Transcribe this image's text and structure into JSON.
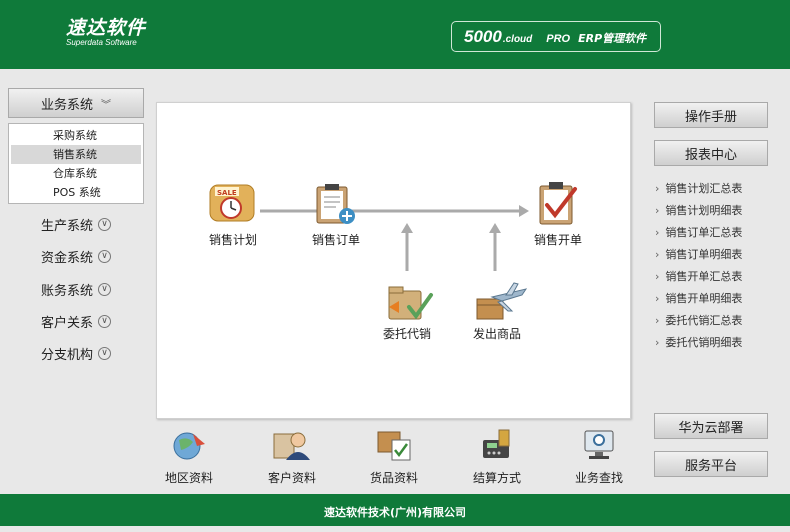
{
  "header": {
    "logo_cn": "速达软件",
    "logo_en": "Superdata Software",
    "brand_num": "5000",
    "brand_cloud": ".cloud",
    "brand_pro": "PRO",
    "brand_erp": "ERP管理软件"
  },
  "sidebar": {
    "active_menu": "业务系统",
    "submenu": [
      "采购系统",
      "销售系统",
      "仓库系统",
      "POS 系统"
    ],
    "selected_submenu": "销售系统",
    "menus": [
      "生产系统",
      "资金系统",
      "账务系统",
      "客户关系",
      "分支机构"
    ]
  },
  "flow": {
    "sales_plan": "销售计划",
    "sales_order": "销售订单",
    "sales_invoice": "销售开单",
    "consignment": "委托代销",
    "ship_goods": "发出商品"
  },
  "right": {
    "manual": "操作手册",
    "report_center": "报表中心",
    "reports": [
      "销售计划汇总表",
      "销售计划明细表",
      "销售订单汇总表",
      "销售订单明细表",
      "销售开单汇总表",
      "销售开单明细表",
      "委托代销汇总表",
      "委托代销明细表"
    ],
    "huawei": "华为云部署",
    "service": "服务平台"
  },
  "bottom": [
    "地区资料",
    "客户资料",
    "货品资料",
    "结算方式",
    "业务查找"
  ],
  "footer": "速达软件技术(广州)有限公司",
  "colors": {
    "brand_green": "#0f7a3a"
  }
}
